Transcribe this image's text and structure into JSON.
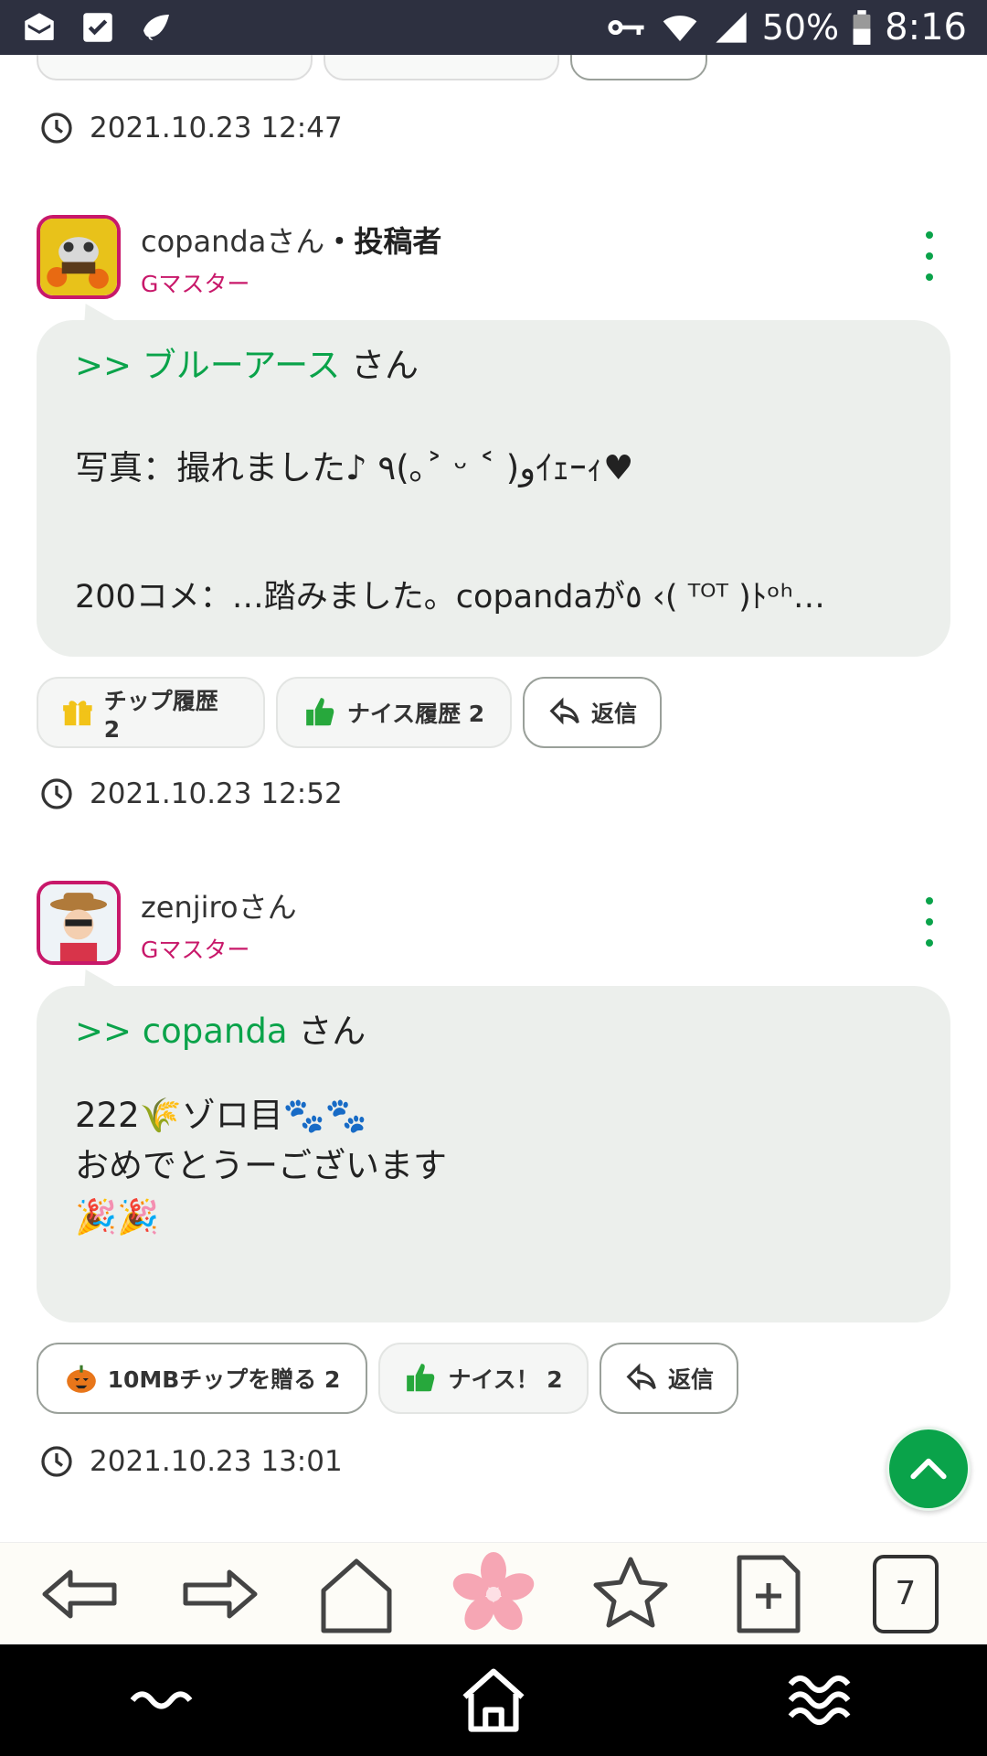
{
  "status_bar": {
    "battery": "50%",
    "time": "8:16"
  },
  "posts": [
    {
      "timestamp": "2021.10.23 12:47"
    },
    {
      "author": "copandaさん",
      "poster_tag": "・投稿者",
      "rank": "Gマスター",
      "reply_to": ">> ブルーアース",
      "reply_suffix": " さん",
      "lines": [
        "写真：撮れました♪ ٩(｡˃ ᵕ ˂ )وｲｪｰｨ♥",
        "200コメ：…踏みました。copandaが٥ ‹( ᵀᴼᵀ )ﾄᵒʰ…"
      ],
      "tip_label": "チップ履歴 2",
      "nice_label": "ナイス履歴 2",
      "reply_label": "返信",
      "timestamp": "2021.10.23 12:52"
    },
    {
      "author": "zenjiroさん",
      "rank": "Gマスター",
      "reply_to": ">> copanda",
      "reply_suffix": " さん",
      "lines": [
        "222🌾ゾロ目🐾🐾",
        "おめでとうーございます",
        "🎉🎉"
      ],
      "tip_label": "10MBチップを贈る 2",
      "nice_label": "ナイス！ 2",
      "reply_label": "返信",
      "timestamp": "2021.10.23 13:01"
    }
  ],
  "browser_toolbar": {
    "tab_count": "7"
  },
  "colors": {
    "accent_green": "#0aa34a",
    "rank_pink": "#c8186a",
    "bubble_bg": "#ecefec",
    "status_bar_bg": "#2d3040"
  },
  "icons": [
    "email-icon",
    "clipboard-check-icon",
    "leaf-icon",
    "key-icon",
    "wifi-icon",
    "signal-icon",
    "battery-icon",
    "clock-icon",
    "more-vert-icon",
    "gift-icon",
    "thumbs-up-icon",
    "reply-icon",
    "pumpkin-icon",
    "arrow-up-icon",
    "back-icon",
    "forward-icon",
    "home-icon",
    "sakura-icon",
    "star-icon",
    "new-tab-icon",
    "recent-apps-icon",
    "home-house-icon",
    "back-nav-icon"
  ]
}
